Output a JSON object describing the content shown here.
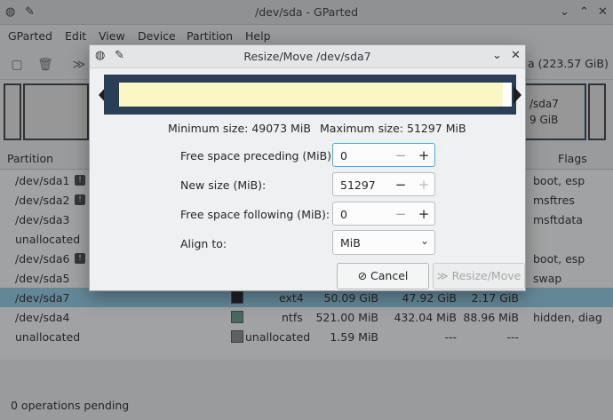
{
  "main": {
    "title": "/dev/sda - GParted",
    "menu": [
      "GParted",
      "Edit",
      "View",
      "Device",
      "Partition",
      "Help"
    ],
    "device_selector": "a (223.57 GiB)",
    "map_labels": {
      "partition": "/sda7",
      "size": "9 GiB"
    },
    "columns": {
      "partition": "Partition",
      "flags": "Flags"
    },
    "rows": [
      {
        "name": "/dev/sda1",
        "info": true,
        "flags": "boot, esp"
      },
      {
        "name": "/dev/sda2",
        "info": true,
        "flags": "msftres"
      },
      {
        "name": "/dev/sda3",
        "info": false,
        "flags": "msftdata"
      },
      {
        "name": "unallocated",
        "info": false,
        "flags": ""
      },
      {
        "name": "/dev/sda6",
        "info": true,
        "flags": "boot, esp"
      },
      {
        "name": "/dev/sda5",
        "info": false,
        "flags": "swap"
      },
      {
        "name": "/dev/sda7",
        "info": false,
        "fs": "ext4",
        "size": "50.09 GiB",
        "used": "47.92 GiB",
        "unused": "2.17 GiB",
        "flags": "",
        "selected": true,
        "swatch": "#1b1b1b"
      },
      {
        "name": "/dev/sda4",
        "info": false,
        "fs": "ntfs",
        "size": "521.00 MiB",
        "used": "432.04 MiB",
        "unused": "88.96 MiB",
        "flags": "hidden, diag",
        "swatch": "#5d9b8c"
      },
      {
        "name": "unallocated",
        "info": false,
        "fs": "unallocated",
        "size": "1.59 MiB",
        "used": "---",
        "unused": "---",
        "flags": "",
        "swatch": "#8a8a8a"
      }
    ],
    "status": "0 operations pending"
  },
  "dialog": {
    "title": "Resize/Move /dev/sda7",
    "min_size": "Minimum size: 49073 MiB",
    "max_size": "Maximum size: 51297 MiB",
    "fields": {
      "preceding": {
        "label": "Free space preceding (MiB):",
        "value": "0"
      },
      "new_size": {
        "label": "New size (MiB):",
        "value": "51297"
      },
      "following": {
        "label": "Free space following (MiB):",
        "value": "0"
      },
      "align": {
        "label": "Align to:",
        "value": "MiB"
      }
    },
    "cancel_label": "Cancel",
    "resize_label": "Resize/Move"
  },
  "colors": {
    "accent": "#3daee9",
    "selection": "#93cee9",
    "resize_frame": "#2a3f57",
    "resize_fill": "#fbf7c4"
  }
}
